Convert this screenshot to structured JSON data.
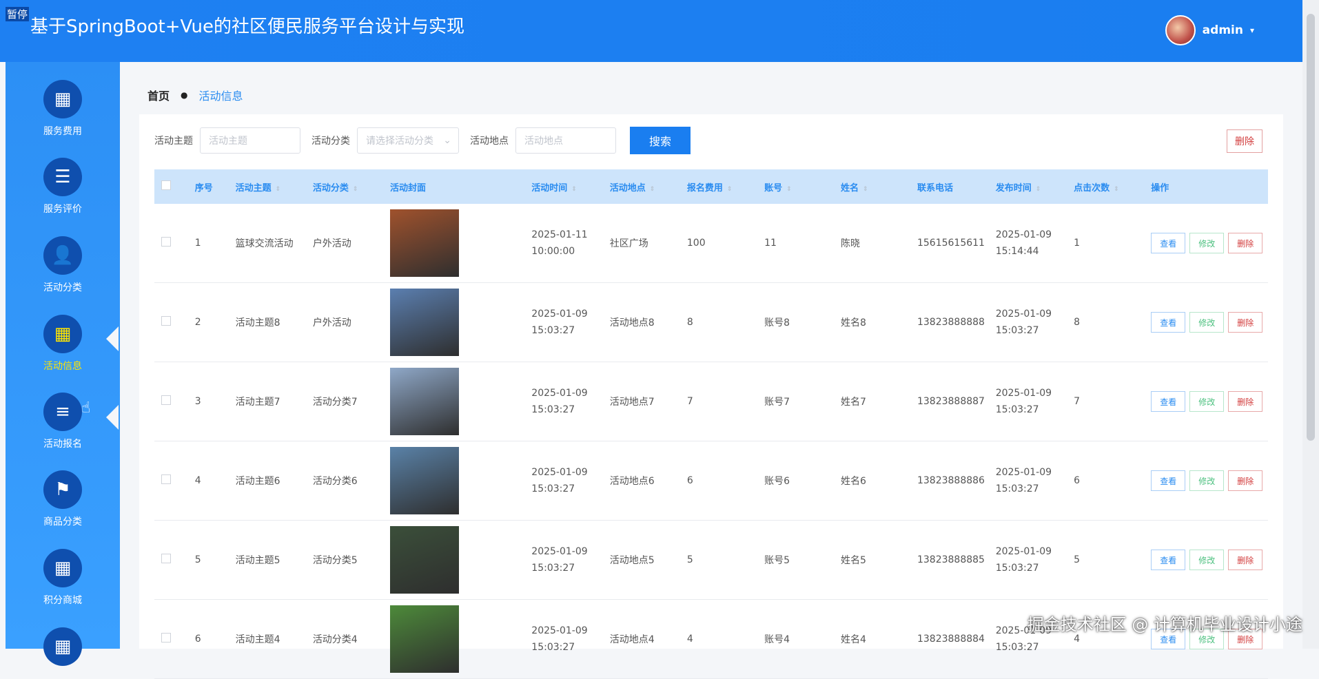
{
  "header": {
    "pause": "暂停",
    "title": "基于SpringBoot+Vue的社区便民服务平台设计与实现",
    "user": "admin",
    "caret": "▾"
  },
  "sidebar": {
    "items": [
      {
        "label": "服务费用",
        "icon": "grid-icon",
        "glyph": "▦",
        "active": false
      },
      {
        "label": "服务评价",
        "icon": "list-icon",
        "glyph": "☰",
        "active": false
      },
      {
        "label": "活动分类",
        "icon": "user-icon",
        "glyph": "👤",
        "active": false
      },
      {
        "label": "活动信息",
        "icon": "grid-icon",
        "glyph": "▦",
        "active": true
      },
      {
        "label": "活动报名",
        "icon": "sliders-icon",
        "glyph": "≡",
        "active": false
      },
      {
        "label": "商品分类",
        "icon": "flag-icon",
        "glyph": "⚑",
        "active": false
      },
      {
        "label": "积分商城",
        "icon": "grid-icon",
        "glyph": "▦",
        "active": false
      },
      {
        "label": "",
        "icon": "grid-icon",
        "glyph": "▦",
        "active": false
      }
    ]
  },
  "breadcrumb": {
    "home": "首页",
    "current": "活动信息"
  },
  "search": {
    "topic_label": "活动主题",
    "topic_placeholder": "活动主题",
    "category_label": "活动分类",
    "category_placeholder": "请选择活动分类",
    "place_label": "活动地点",
    "place_placeholder": "活动地点",
    "search_button": "搜索",
    "delete_button": "删除"
  },
  "table": {
    "headers": [
      "序号",
      "活动主题",
      "活动分类",
      "活动封面",
      "活动时间",
      "活动地点",
      "报名费用",
      "账号",
      "姓名",
      "联系电话",
      "发布时间",
      "点击次数",
      "操作"
    ],
    "actions": {
      "view": "查看",
      "edit": "修改",
      "delete": "删除"
    },
    "rows": [
      {
        "no": "1",
        "topic": "篮球交流活动",
        "category": "户外活动",
        "time": "2025-01-11 10:00:00",
        "place": "社区广场",
        "fee": "100",
        "account": "11",
        "name": "陈晓",
        "phone": "15615615611",
        "published": "2025-01-09 15:14:44",
        "clicks": "1",
        "cover_color": "#a0522d"
      },
      {
        "no": "2",
        "topic": "活动主题8",
        "category": "户外活动",
        "time": "2025-01-09 15:03:27",
        "place": "活动地点8",
        "fee": "8",
        "account": "账号8",
        "name": "姓名8",
        "phone": "13823888888",
        "published": "2025-01-09 15:03:27",
        "clicks": "8",
        "cover_color": "#5b7fb0"
      },
      {
        "no": "3",
        "topic": "活动主题7",
        "category": "活动分类7",
        "time": "2025-01-09 15:03:27",
        "place": "活动地点7",
        "fee": "7",
        "account": "账号7",
        "name": "姓名7",
        "phone": "13823888887",
        "published": "2025-01-09 15:03:27",
        "clicks": "7",
        "cover_color": "#8fa8c8"
      },
      {
        "no": "4",
        "topic": "活动主题6",
        "category": "活动分类6",
        "time": "2025-01-09 15:03:27",
        "place": "活动地点6",
        "fee": "6",
        "account": "账号6",
        "name": "姓名6",
        "phone": "13823888886",
        "published": "2025-01-09 15:03:27",
        "clicks": "6",
        "cover_color": "#5a82a8"
      },
      {
        "no": "5",
        "topic": "活动主题5",
        "category": "活动分类5",
        "time": "2025-01-09 15:03:27",
        "place": "活动地点5",
        "fee": "5",
        "account": "账号5",
        "name": "姓名5",
        "phone": "13823888885",
        "published": "2025-01-09 15:03:27",
        "clicks": "5",
        "cover_color": "#3b4f3a"
      },
      {
        "no": "6",
        "topic": "活动主题4",
        "category": "活动分类4",
        "time": "2025-01-09 15:03:27",
        "place": "活动地点4",
        "fee": "4",
        "account": "账号4",
        "name": "姓名4",
        "phone": "13823888884",
        "published": "2025-01-09 15:03:27",
        "clicks": "4",
        "cover_color": "#4d8a3a"
      }
    ]
  },
  "watermark": "掘金技术社区 @ 计算机毕业设计小途"
}
